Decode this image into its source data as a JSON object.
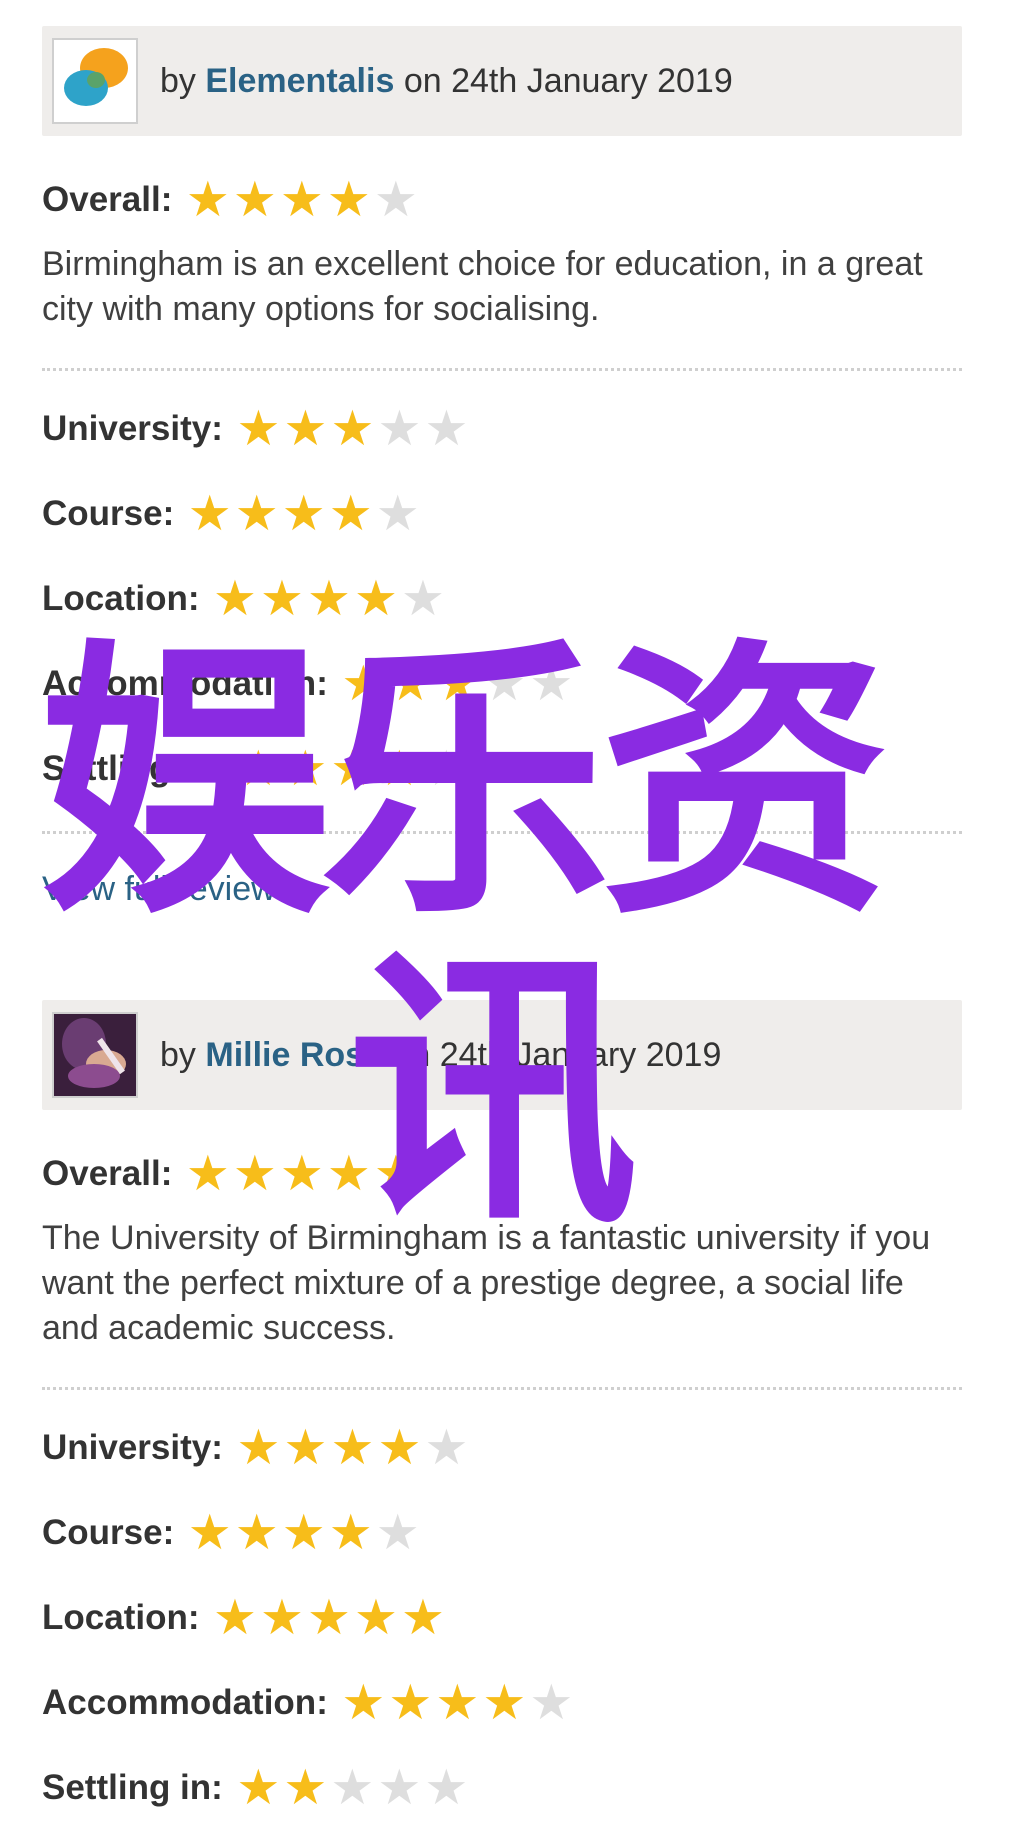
{
  "colors": {
    "star_on": "#f7bd1a",
    "star_off": "#dedede",
    "link": "#2a6285",
    "watermark": "#8a2be2",
    "header_bg": "#efedeb"
  },
  "reviews": [
    {
      "by": "by",
      "author": "Elementalis",
      "date": "on 24th January 2019",
      "avatar": "orange-blue-speech-bubble-avatar",
      "overall_label": "Overall:",
      "overall_rating": 4,
      "text": "Birmingham is an excellent choice for education, in a great city with many options for socialising.",
      "categories": [
        {
          "label": "University:",
          "rating": 3
        },
        {
          "label": "Course:",
          "rating": 4
        },
        {
          "label": "Location:",
          "rating": 4
        },
        {
          "label": "Accommodation:",
          "rating": 3
        },
        {
          "label": "Settling in:",
          "rating": 4
        }
      ],
      "view_full": "View full review"
    },
    {
      "by": "by",
      "author": "Millie Rose",
      "date": "on 24th January 2019",
      "avatar": "photo-avatar",
      "overall_label": "Overall:",
      "overall_rating": 5,
      "text": "The University of Birmingham is a fantastic university if you want the perfect mixture of a prestige degree, a social life and academic success.",
      "categories": [
        {
          "label": "University:",
          "rating": 4
        },
        {
          "label": "Course:",
          "rating": 4
        },
        {
          "label": "Location:",
          "rating": 5
        },
        {
          "label": "Accommodation:",
          "rating": 4
        },
        {
          "label": "Settling in:",
          "rating": 2
        }
      ]
    }
  ],
  "watermark": {
    "line1": "娱乐资",
    "line2": "讯"
  }
}
